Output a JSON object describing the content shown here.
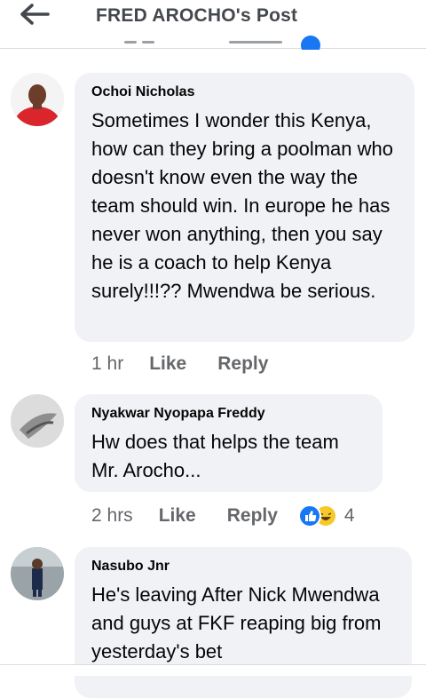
{
  "header": {
    "title": "FRED AROCHO's Post"
  },
  "comments": [
    {
      "author": "Ochoi Nicholas",
      "text": "Sometimes I wonder this Kenya, how can they bring a poolman who doesn't know even the way the team should win. In europe he has never won anything, then you say he is a coach to help Kenya surely!!!?? Mwendwa be serious.",
      "time": "1 hr",
      "like_label": "Like",
      "reply_label": "Reply"
    },
    {
      "author": "Nyakwar Nyopapa Freddy",
      "text": "Hw does that helps the team Mr. Arocho...",
      "time": "2 hrs",
      "like_label": "Like",
      "reply_label": "Reply",
      "reaction_count": "4",
      "reactions": [
        "like-icon",
        "haha-icon"
      ]
    },
    {
      "author": "Nasubo Jnr",
      "text": "He's leaving After Nick Mwendwa and guys at FKF reaping big from yesterday's bet"
    }
  ],
  "colors": {
    "accent": "#1877f2",
    "bubble": "#f0f2f5",
    "meta": "#65676b"
  }
}
